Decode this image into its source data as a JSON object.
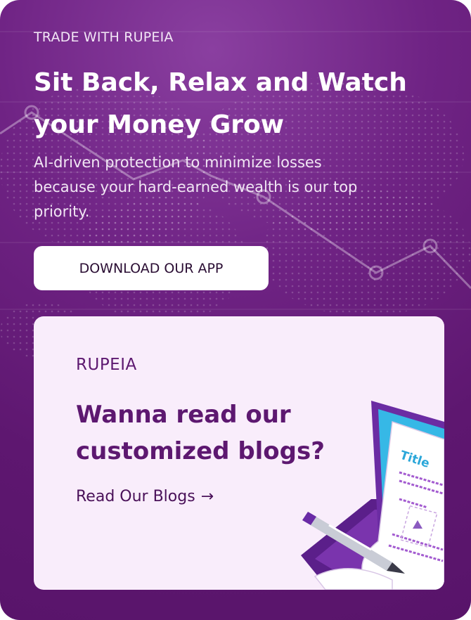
{
  "hero": {
    "eyebrow": "TRADE WITH RUPEIA",
    "headline_line1": "Sit Back, Relax and Watch",
    "headline_line2": "your Money Grow",
    "subtext": "AI-driven protection to minimize losses because your hard-earned wealth is our top priority.",
    "cta_label": "DOWNLOAD OUR APP"
  },
  "blog_card": {
    "brand": "RUPEIA",
    "title_line1": "Wanna read our",
    "title_line2": "customized blogs?",
    "link_label": "Read Our Blogs",
    "link_arrow": "→",
    "illustration_title": "Title"
  },
  "colors": {
    "background": "#6f2384",
    "card": "#f9edfb",
    "brand_text": "#5d1870",
    "button_bg": "#ffffff"
  },
  "icons": [
    "world-map-dots",
    "line-chart-decoration",
    "arrow-right-icon",
    "laptop-blog-illustration",
    "pen-icon"
  ]
}
